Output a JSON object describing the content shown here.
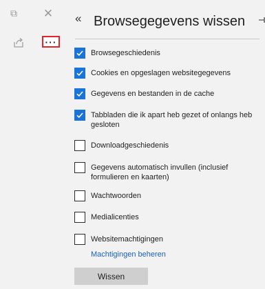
{
  "chrome": {
    "restore_glyph": "⧉",
    "close_glyph": "✕",
    "share_glyph": "⇪",
    "more_glyph": "···"
  },
  "panel": {
    "back_glyph": "«",
    "title": "Browsegegevens wissen",
    "pin_glyph": "⊣",
    "options": [
      {
        "label": "Browsegeschiedenis",
        "checked": true
      },
      {
        "label": "Cookies en opgeslagen websitegegevens",
        "checked": true
      },
      {
        "label": "Gegevens en bestanden in de cache",
        "checked": true
      },
      {
        "label": "Tabbladen die ik apart heb gezet of onlangs heb gesloten",
        "checked": true
      },
      {
        "label": "Downloadgeschiedenis",
        "checked": false
      },
      {
        "label": "Gegevens automatisch invullen (inclusief formulieren en kaarten)",
        "checked": false
      },
      {
        "label": "Wachtwoorden",
        "checked": false
      },
      {
        "label": "Medialicenties",
        "checked": false
      },
      {
        "label": "Websitemachtigingen",
        "checked": false
      }
    ],
    "manage_link": "Machtigingen beheren",
    "clear_button": "Wissen"
  },
  "colors": {
    "accent": "#1a73d8",
    "highlight_border": "#e0262a",
    "link": "#1660c9"
  }
}
